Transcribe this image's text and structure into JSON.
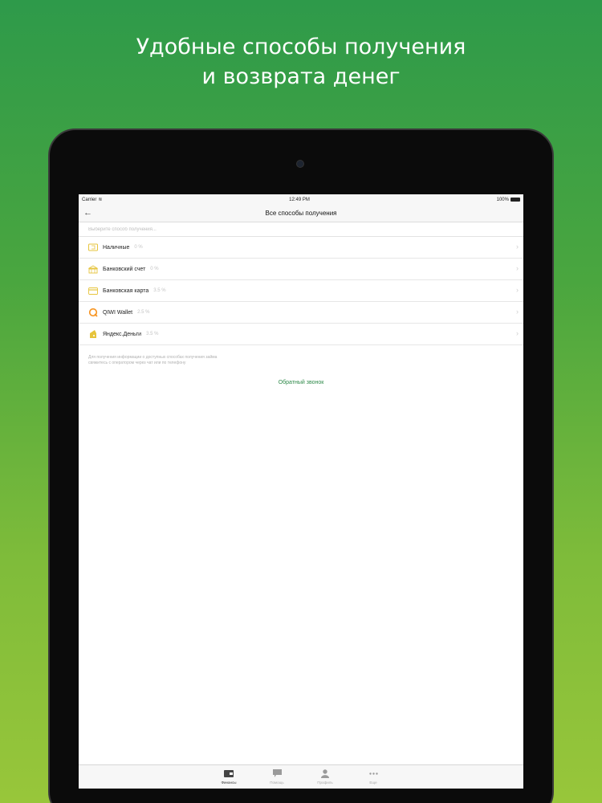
{
  "headline": {
    "line1": "Удобные способы получения",
    "line2": "и возврата денег"
  },
  "status_bar": {
    "carrier": "Carrier",
    "time": "12:49 PM",
    "battery": "100%"
  },
  "nav": {
    "title": "Все способы получения"
  },
  "search": {
    "placeholder": "Выберите способ получения..."
  },
  "methods": [
    {
      "label": "Наличные",
      "fee": "0 %",
      "icon": "cash-icon"
    },
    {
      "label": "Банковский счет",
      "fee": "0 %",
      "icon": "bank-account-icon"
    },
    {
      "label": "Банковская карта",
      "fee": "3.5 %",
      "icon": "bank-card-icon"
    },
    {
      "label": "QIWI Wallet",
      "fee": "2.5 %",
      "icon": "qiwi-icon"
    },
    {
      "label": "Яндекс.Деньги",
      "fee": "3.5 %",
      "icon": "yandex-money-icon"
    }
  ],
  "info": {
    "text": "Для получения информации о доступных способах получения займа свяжитесь с оператором через чат или по телефону"
  },
  "callback": {
    "label": "Обратный звонок"
  },
  "tabs": [
    {
      "label": "Финансы",
      "icon": "finance-icon",
      "active": true
    },
    {
      "label": "Помощь",
      "icon": "chat-icon",
      "active": false
    },
    {
      "label": "Профиль",
      "icon": "profile-icon",
      "active": false
    },
    {
      "label": "Еще",
      "icon": "more-icon",
      "active": false
    }
  ],
  "colors": {
    "accent": "#2f8a4a",
    "icon_yellow": "#e6c43c",
    "qiwi_orange": "#f7931e",
    "background_top": "#2e9a4a",
    "background_bottom": "#98c63a"
  }
}
